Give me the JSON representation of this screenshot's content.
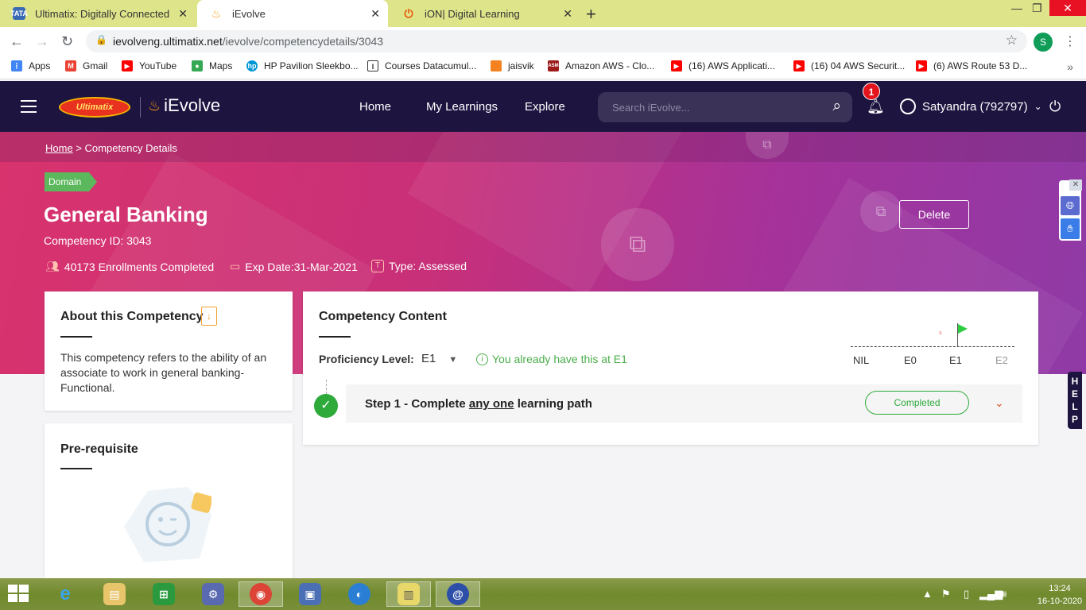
{
  "browser": {
    "tabs": [
      {
        "title": "Ultimatix: Digitally Connected",
        "favicon": "TATA",
        "favicon_color": "#3b6ab5"
      },
      {
        "title": "iEvolve",
        "favicon": "flame",
        "favicon_color": "#f39c12"
      },
      {
        "title": "iON| Digital Learning",
        "favicon": "power",
        "favicon_color": "#e8590c"
      }
    ],
    "url_host": "ievolveng.ultimatix.net",
    "url_path": "/ievolve/competencydetails/3043",
    "profile_initial": "S",
    "bookmarks": [
      {
        "label": "Apps",
        "icon": "apps-grid-icon",
        "color": "#4285f4"
      },
      {
        "label": "Gmail",
        "icon": "gmail-icon",
        "color": "#ea4335"
      },
      {
        "label": "YouTube",
        "icon": "youtube-icon",
        "color": "#ff0000"
      },
      {
        "label": "Maps",
        "icon": "maps-pin-icon",
        "color": "#34a853"
      },
      {
        "label": "HP Pavilion Sleekbo...",
        "icon": "hp-icon",
        "color": "#0096d6"
      },
      {
        "label": "Courses Datacumul...",
        "icon": "bracket-icon",
        "color": "#333333"
      },
      {
        "label": "jaisvik",
        "icon": "hexagon-icon",
        "color": "#f58220"
      },
      {
        "label": "Amazon AWS - Clo...",
        "icon": "asm-icon",
        "color": "#9c1a1a"
      },
      {
        "label": "(16) AWS Applicati...",
        "icon": "youtube-icon",
        "color": "#ff0000"
      },
      {
        "label": "(16) 04 AWS Securit...",
        "icon": "youtube-icon",
        "color": "#ff0000"
      },
      {
        "label": "(6) AWS Route 53 D...",
        "icon": "youtube-icon",
        "color": "#ff0000"
      }
    ]
  },
  "header": {
    "brand_left": "Ultimatix",
    "brand_right": "iEvolve",
    "nav": [
      "Home",
      "My Learnings",
      "Explore"
    ],
    "search_placeholder": "Search iEvolve...",
    "notification_count": "1",
    "user_name": "Satyandra (792797)"
  },
  "hero": {
    "breadcrumb_home": "Home",
    "breadcrumb_sep": ">",
    "breadcrumb_current": "Competency Details",
    "domain_tag": "Domain",
    "title": "General Banking",
    "competency_id": "Competency ID: 3043",
    "enrollments": "40173 Enrollments Completed",
    "exp_date": "Exp Date:31-Mar-2021",
    "type": "Type: Assessed",
    "type_icon_letter": "T",
    "delete_label": "Delete"
  },
  "about": {
    "title": "About this Competency",
    "text": "This competency refers to the ability of an associate to work in general banking-Functional."
  },
  "prerequisite": {
    "title": "Pre-requisite"
  },
  "content": {
    "title": "Competency Content",
    "proficiency_label": "Proficiency Level:",
    "proficiency_value": "E1",
    "proficiency_note": "You already have this at E1",
    "scale": [
      "NIL",
      "E0",
      "E1",
      "E2"
    ],
    "step_prefix": "Step 1 - Complete ",
    "step_emph": "any one",
    "step_suffix": " learning path",
    "step_status": "Completed"
  },
  "side": {
    "help_letters": [
      "H",
      "E",
      "L",
      "P"
    ]
  },
  "taskbar": {
    "time": "13:24",
    "date": "16-10-2020"
  }
}
